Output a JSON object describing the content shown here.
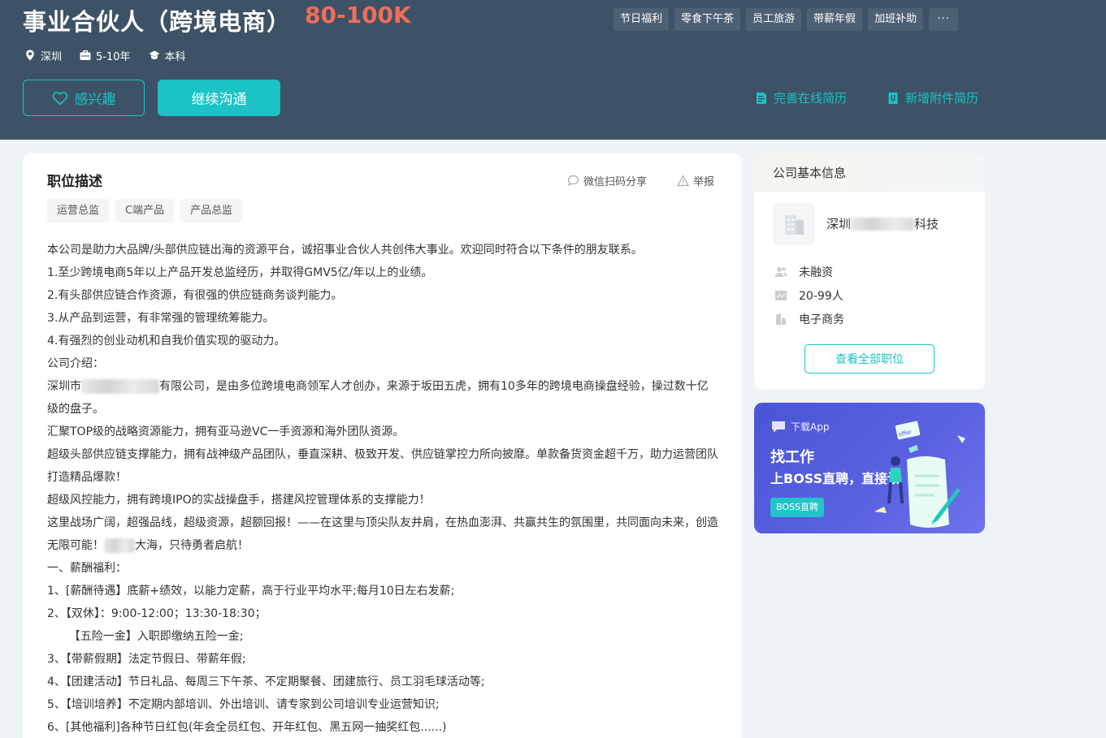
{
  "header": {
    "job_title": "事业合伙人（跨境电商）",
    "salary": "80-100K",
    "benefit_tags": [
      "节日福利",
      "零食下午茶",
      "员工旅游",
      "带薪年假",
      "加班补助"
    ],
    "more_label": "···",
    "meta": {
      "city": "深圳",
      "experience": "5-10年",
      "education": "本科"
    },
    "interest_label": "感兴趣",
    "chat_label": "继续沟通",
    "complete_resume_label": "完善在线简历",
    "add_attachment_label": "新增附件简历"
  },
  "job": {
    "section_title": "职位描述",
    "share_label": "微信扫码分享",
    "report_label": "举报",
    "skill_tags": [
      "运营总监",
      "C端产品",
      "产品总监"
    ],
    "description": [
      "本公司是助力大品牌/头部供应链出海的资源平台，诚招事业合伙人共创伟大事业。欢迎同时符合以下条件的朋友联系。",
      "1.至少跨境电商5年以上产品开发总监经历，并取得GMV5亿/年以上的业绩。",
      "2.有头部供应链合作资源，有很强的供应链商务谈判能力。",
      "3.从产品到运营，有非常强的管理统筹能力。",
      "4.有强烈的创业动机和自我价值实现的驱动力。",
      "公司介绍：",
      {
        "prefix": "深圳市",
        "suffix": "有限公司，是由多位跨境电商领军人才创办，来源于坂田五虎，拥有10多年的跨境电商操盘经验，操过数十亿级的盘子。"
      },
      "汇聚TOP级的战略资源能力，拥有亚马逊VC一手资源和海外团队资源。",
      "超级头部供应链支撑能力，拥有战神级产品团队，垂直深耕、极致开发、供应链掌控力所向披靡。单款备货资金超千万，助力运营团队打造精品爆款！",
      "超级风控能力，拥有跨境IPO的实战操盘手，搭建风控管理体系的支撑能力！",
      {
        "prefix": "这里战场广阔，超强品线，超级资源，超额回报！——在这里与顶尖队友并肩，在热血澎湃、共赢共生的氛围里，共同面向未来，创造无限可能！",
        "suffix": "大海，只待勇者启航！"
      },
      "一、薪酬福利：",
      "1、[薪酬待遇】底薪+绩效，以能力定薪，高于行业平均水平;每月10日左右发薪;",
      "2、【双休】：9:00-12:00；13:30-18:30；",
      "      【五险一金】入职即缴纳五险一金;",
      "3、【带薪假期】法定节假日、带薪年假;",
      "4、【团建活动】节日礼品、每周三下午茶、不定期聚餐、团建旅行、员工羽毛球活动等;",
      "5、【培训培养】不定期内部培训、外出培训、请专家到公司培训专业运营知识;",
      "6、[其他福利]各种节日红包(年会全员红包、开年红包、黑五网一抽奖红包......)"
    ]
  },
  "company": {
    "section_title": "公司基本信息",
    "name_prefix": "深圳",
    "name_suffix": "科技",
    "funding": "未融资",
    "size": "20-99人",
    "industry": "电子商务",
    "all_jobs_label": "查看全部职位"
  },
  "banner": {
    "small_label": "下载App",
    "headline": "找工作",
    "subline": "上BOSS直聘，直接谈",
    "button_label": "BOSS直聘",
    "art_badge": "offer"
  },
  "colors": {
    "header_bg": "#3d5266",
    "accent": "#1bc3c6",
    "salary": "#f26d5b",
    "banner": "#5159dc"
  }
}
